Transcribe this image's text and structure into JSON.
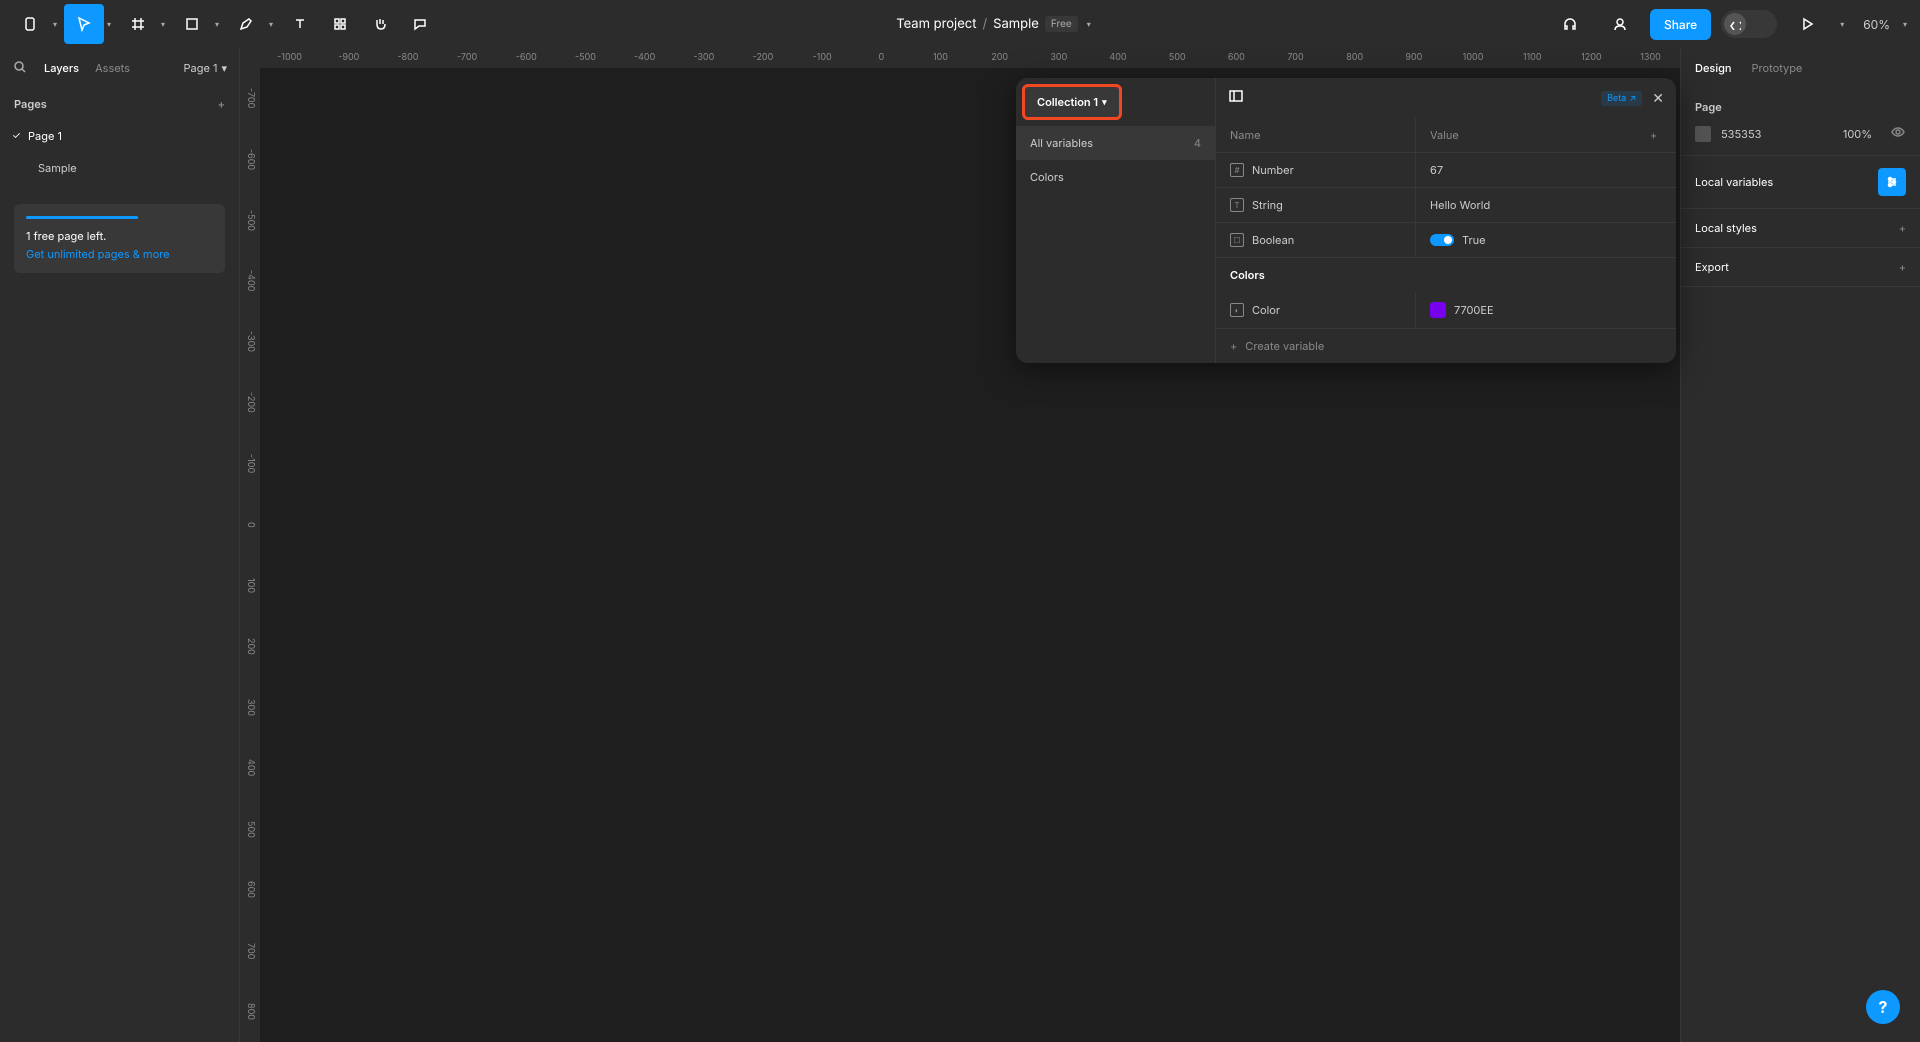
{
  "toolbar": {
    "project": "Team project",
    "file": "Sample",
    "plan": "Free",
    "share": "Share",
    "zoom": "60%"
  },
  "left": {
    "tab_layers": "Layers",
    "tab_assets": "Assets",
    "page_dropdown": "Page 1",
    "pages_label": "Pages",
    "pages": [
      "Page 1"
    ],
    "layers": [
      "Sample"
    ],
    "promo_line1": "1 free page left.",
    "promo_link": "Get unlimited pages & more"
  },
  "ruler_h": [
    "-1000",
    "-900",
    "-800",
    "-700",
    "-600",
    "-500",
    "-400",
    "-300",
    "-200",
    "-100",
    "0",
    "100",
    "200",
    "300",
    "400",
    "500",
    "600",
    "700",
    "800",
    "900",
    "1000",
    "1100",
    "1200",
    "1300"
  ],
  "ruler_v": [
    "-700",
    "-600",
    "-500",
    "-400",
    "-300",
    "-200",
    "-100",
    "0",
    "100",
    "200",
    "300",
    "400",
    "500",
    "600",
    "700",
    "800"
  ],
  "right": {
    "tab_design": "Design",
    "tab_prototype": "Prototype",
    "page_label": "Page",
    "bg_color": "535353",
    "bg_opacity": "100%",
    "local_vars": "Local variables",
    "local_styles": "Local styles",
    "export": "Export"
  },
  "modal": {
    "collection": "Collection 1",
    "sidebar": {
      "all": "All variables",
      "all_count": "4",
      "groups": [
        "Colors"
      ]
    },
    "beta": "Beta",
    "th_name": "Name",
    "th_value": "Value",
    "variables": [
      {
        "type": "number",
        "name": "Number",
        "value": "67"
      },
      {
        "type": "string",
        "name": "String",
        "value": "Hello World"
      },
      {
        "type": "boolean",
        "name": "Boolean",
        "value": "True"
      }
    ],
    "group_label": "Colors",
    "color_var": {
      "name": "Color",
      "value": "7700EE",
      "swatch": "#7700EE"
    },
    "create": "Create variable"
  },
  "help": "?"
}
